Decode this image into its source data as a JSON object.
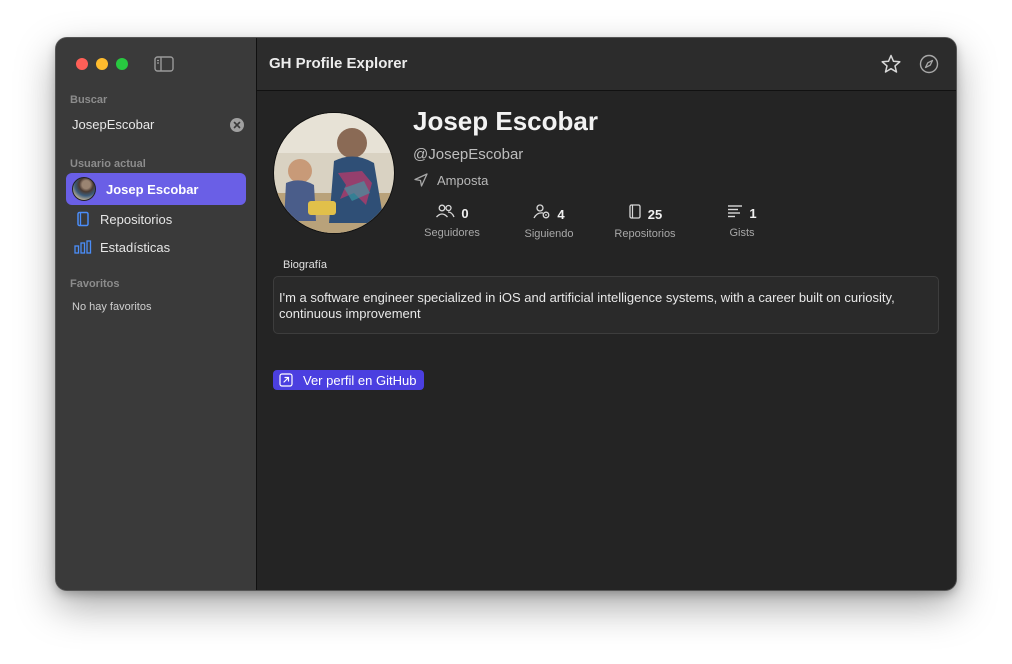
{
  "app": {
    "title": "GH Profile Explorer"
  },
  "sidebar": {
    "search_label": "Buscar",
    "search_value": "JosepEscobar",
    "current_user_label": "Usuario actual",
    "items": [
      {
        "label": "Josep Escobar",
        "icon": "avatar"
      },
      {
        "label": "Repositorios",
        "icon": "book-icon"
      },
      {
        "label": "Estadísticas",
        "icon": "bar-chart-icon"
      }
    ],
    "favorites_label": "Favoritos",
    "favorites_empty": "No hay favoritos"
  },
  "profile": {
    "name": "Josep Escobar",
    "handle": "@JosepEscobar",
    "location": "Amposta",
    "stats": [
      {
        "value": "0",
        "label": "Seguidores",
        "icon": "people-icon"
      },
      {
        "value": "4",
        "label": "Siguiendo",
        "icon": "person-gear-icon"
      },
      {
        "value": "25",
        "label": "Repositorios",
        "icon": "book-icon"
      },
      {
        "value": "1",
        "label": "Gists",
        "icon": "text-lines-icon"
      }
    ],
    "bio_label": "Biografía",
    "bio": "I'm a software engineer specialized in iOS and artificial intelligence systems, with a career built on curiosity, continuous improvement",
    "github_button": "Ver perfil en GitHub"
  },
  "colors": {
    "accent": "#6a5fe6",
    "button": "#4b3fe0",
    "sidebar_bg": "#3a3a3a",
    "main_bg": "#242424"
  }
}
